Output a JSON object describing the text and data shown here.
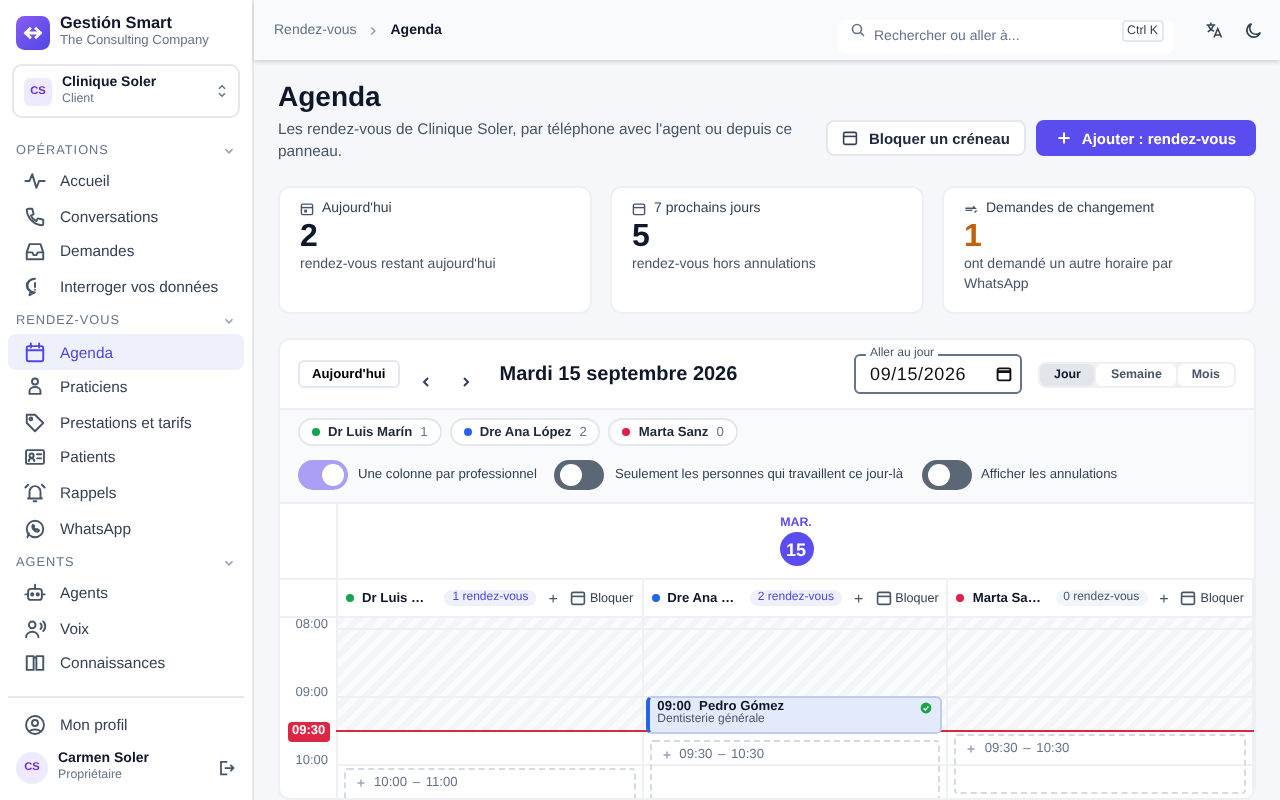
{
  "brand": {
    "title": "Gestión Smart",
    "subtitle": "The Consulting Company"
  },
  "account": {
    "initials": "CS",
    "name": "Clinique Soler",
    "role": "Client"
  },
  "nav_sections": [
    {
      "title": "OPÉRATIONS",
      "expanded": true,
      "items": [
        {
          "label": "Accueil",
          "selected": false
        },
        {
          "label": "Conversations",
          "selected": false
        },
        {
          "label": "Demandes",
          "selected": false
        },
        {
          "label": "Interroger vos données",
          "selected": false
        }
      ]
    },
    {
      "title": "RENDEZ-VOUS",
      "expanded": true,
      "items": [
        {
          "label": "Agenda",
          "selected": true
        },
        {
          "label": "Praticiens",
          "selected": false
        },
        {
          "label": "Prestations et tarifs",
          "selected": false
        },
        {
          "label": "Patients",
          "selected": false
        },
        {
          "label": "Rappels",
          "selected": false
        },
        {
          "label": "WhatsApp",
          "selected": false
        }
      ]
    },
    {
      "title": "AGENTS",
      "expanded": true,
      "items": [
        {
          "label": "Agents",
          "selected": false
        },
        {
          "label": "Voix",
          "selected": false
        },
        {
          "label": "Connaissances",
          "selected": false
        }
      ]
    }
  ],
  "profile_link": "Mon profil",
  "user": {
    "initials": "CS",
    "name": "Carmen Soler",
    "role": "Propriétaire"
  },
  "breadcrumb": [
    {
      "label": "Rendez-vous",
      "selected": false
    },
    {
      "label": "Agenda",
      "selected": true
    }
  ],
  "search": {
    "placeholder": "Rechercher ou aller à...",
    "shortcut": "Ctrl K"
  },
  "page": {
    "title": "Agenda",
    "description": "Les rendez-vous de Clinique Soler, par téléphone avec l'agent ou depuis ce panneau."
  },
  "actions": [
    {
      "kind": "secondary",
      "label": "Bloquer un créneau"
    },
    {
      "kind": "primary",
      "label": "Ajouter : rendez-vous"
    }
  ],
  "stats": [
    {
      "label": "Aujourd'hui",
      "value": "2",
      "caption": "rendez-vous restant aujourd'hui",
      "alert": false
    },
    {
      "label": "7 prochains jours",
      "value": "5",
      "caption": "rendez-vous hors annulations",
      "alert": false
    },
    {
      "label": "Demandes de changement",
      "value": "1",
      "caption": "ont demandé un autre horaire par WhatsApp",
      "alert": true
    }
  ],
  "calendar": {
    "today_button": "Aujourd'hui",
    "date_title": "Mardi 15 septembre 2026",
    "date_field": {
      "label": "Aller au jour",
      "value": "09/15/2026"
    },
    "views": [
      {
        "label": "Jour",
        "selected": true
      },
      {
        "label": "Semaine",
        "selected": false
      },
      {
        "label": "Mois",
        "selected": false
      }
    ],
    "practitioners": [
      {
        "name": "Dr Luis Marín",
        "count": "1",
        "color": "#16a34a"
      },
      {
        "name": "Dre Ana López",
        "count": "2",
        "color": "#2563eb"
      },
      {
        "name": "Marta Sanz",
        "count": "0",
        "color": "#e11d48"
      }
    ],
    "toggles": [
      {
        "label": "Une colonne par professionnel",
        "on": true
      },
      {
        "label": "Seulement les personnes qui travaillent ce jour-là",
        "on": false
      },
      {
        "label": "Afficher les annulations",
        "on": false
      }
    ],
    "day": {
      "weekday": "MAR.",
      "number": "15"
    },
    "columns": [
      {
        "name": "Dr Luis …",
        "color": "#16a34a",
        "badge": "1 rendez-vous",
        "busy": true,
        "add": "+",
        "block": "Bloquer",
        "events": [
          {
            "kind": "free",
            "time": "10:00 – 11:00"
          }
        ]
      },
      {
        "name": "Dre Ana …",
        "color": "#2563eb",
        "badge": "2 rendez-vous",
        "busy": true,
        "add": "+",
        "block": "Bloquer",
        "events": [
          {
            "kind": "appointment",
            "start": "09:00",
            "patient": "Pedro Gómez",
            "service": "Dentisterie générale",
            "confirmed": true
          },
          {
            "kind": "free",
            "time": "09:30 – 10:30"
          }
        ]
      },
      {
        "name": "Marta Sa…",
        "color": "#e11d48",
        "badge": "0 rendez-vous",
        "busy": false,
        "add": "+",
        "block": "Bloquer",
        "events": [
          {
            "kind": "free",
            "time": "09:30 – 10:30"
          }
        ]
      }
    ],
    "hours": [
      "08:00",
      "09:00",
      "10:00"
    ],
    "now": "09:30"
  }
}
